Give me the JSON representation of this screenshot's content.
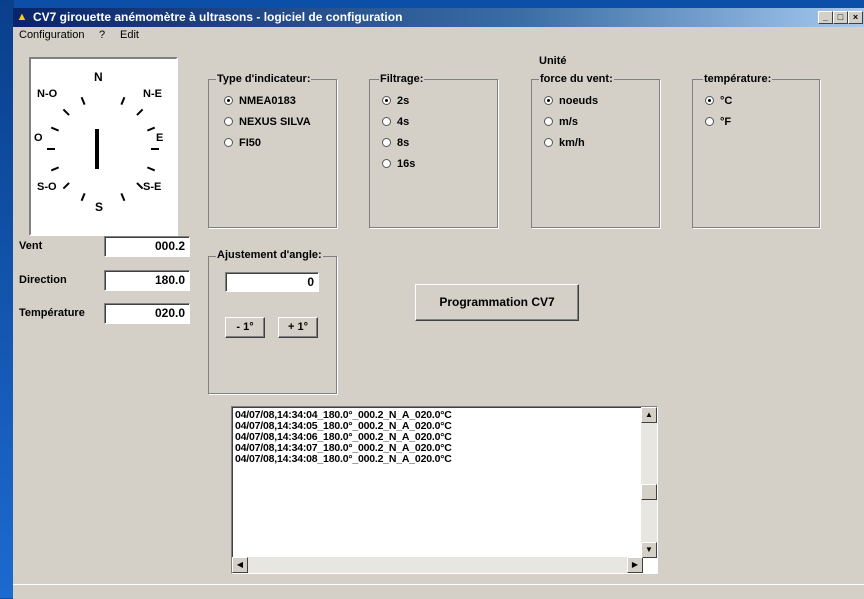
{
  "window": {
    "title": "CV7 girouette anémomètre à ultrasons - logiciel de configuration"
  },
  "menu": [
    "Configuration",
    "?",
    "Edit"
  ],
  "compass": {
    "labels": {
      "n": "N",
      "ne": "N-E",
      "e": "E",
      "se": "S-E",
      "s": "S",
      "so": "S-O",
      "o": "O",
      "no": "N-O"
    },
    "direction_deg": 180.0
  },
  "readings": [
    {
      "label": "Vent",
      "value": "000.2"
    },
    {
      "label": "Direction",
      "value": "180.0"
    },
    {
      "label": "Température",
      "value": "020.0"
    }
  ],
  "type_indicateur": {
    "label": "Type d'indicateur:",
    "options": [
      {
        "label": "NMEA0183",
        "selected": true
      },
      {
        "label": "NEXUS SILVA",
        "selected": false
      },
      {
        "label": "FI50",
        "selected": false
      }
    ]
  },
  "filtrage": {
    "label": "Filtrage:",
    "options": [
      {
        "label": "2s",
        "selected": true
      },
      {
        "label": "4s",
        "selected": false
      },
      {
        "label": "8s",
        "selected": false
      },
      {
        "label": "16s",
        "selected": false
      }
    ]
  },
  "unite": {
    "heading": "Unité",
    "force": {
      "label": "force du vent:",
      "options": [
        {
          "label": "noeuds",
          "selected": true
        },
        {
          "label": "m/s",
          "selected": false
        },
        {
          "label": "km/h",
          "selected": false
        }
      ]
    },
    "temperature": {
      "label": "température:",
      "options": [
        {
          "label": "°C",
          "selected": true
        },
        {
          "label": "°F",
          "selected": false
        }
      ]
    }
  },
  "angle": {
    "label": "Ajustement d'angle:",
    "value": "0",
    "minus_label": "- 1°",
    "plus_label": "+ 1°"
  },
  "program_button": "Programmation CV7",
  "log_lines": [
    "04/07/08,14:34:04_180.0°_000.2_N_A_020.0°C",
    "04/07/08,14:34:05_180.0°_000.2_N_A_020.0°C",
    "04/07/08,14:34:06_180.0°_000.2_N_A_020.0°C",
    "04/07/08,14:34:07_180.0°_000.2_N_A_020.0°C",
    "04/07/08,14:34:08_180.0°_000.2_N_A_020.0°C"
  ]
}
